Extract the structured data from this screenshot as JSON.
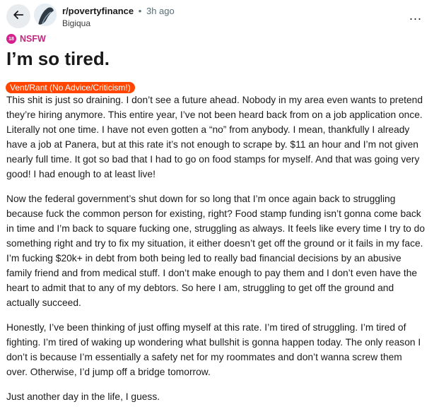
{
  "header": {
    "subreddit": "r/povertyfinance",
    "separator": "•",
    "time_ago": "3h ago",
    "author": "Bigiqua",
    "more_label": "..."
  },
  "icons": {
    "back": "arrow-left-icon",
    "more": "more-horizontal-icon",
    "nsfw": "nsfw-18-icon"
  },
  "nsfw": {
    "badge": "18",
    "label": "NSFW"
  },
  "post": {
    "title": "I’m so tired.",
    "flair": "Vent/Rant (No Advice/Criticism!)",
    "paragraphs": [
      "This shit is just so draining. I don’t see a future ahead. Nobody in my area even wants to pretend they’re hiring anymore. This entire year, I’ve not been heard back from on a job application once. Literally not one time. I have not even gotten a “no” from anybody. I mean, thankfully I already have a job at Panera, but at this rate it’s not enough to scrape by. $11 an hour and I’m not given nearly full time. It got so bad that I had to go on food stamps for myself. And that was going very good! I had enough to at least live!",
      "Now the federal government’s shut down for so long that I’m once again back to struggling because fuck the common person for existing, right? Food stamp funding isn’t gonna come back in time and I’m back to square fucking one, struggling as always. It feels like every time I try to do something right and try to fix my situation, it either doesn’t get off the ground or it fails in my face. I’m fucking $20k+ in debt from both being led to really bad financial decisions by an abusive family friend and from medical stuff. I don’t make enough to pay them and I don’t even have the heart to admit that to any of my debtors. So here I am, struggling to get off the ground and actually succeed.",
      "Honestly, I’ve been thinking of just offing myself at this rate. I’m tired of struggling. I’m tired of fighting. I’m tired of waking up wondering what bullshit is gonna happen today. The only reason I don’t is because I’m essentially a safety net for my roommates and don’t wanna screw them over. Otherwise, I’d jump off a bridge tomorrow.",
      "Just another day in the life, I guess."
    ]
  },
  "colors": {
    "flair_bg": "#ff4500",
    "nsfw": "#d5208e",
    "back_button_bg": "#e9ecef",
    "meta_text": "#576f76"
  }
}
